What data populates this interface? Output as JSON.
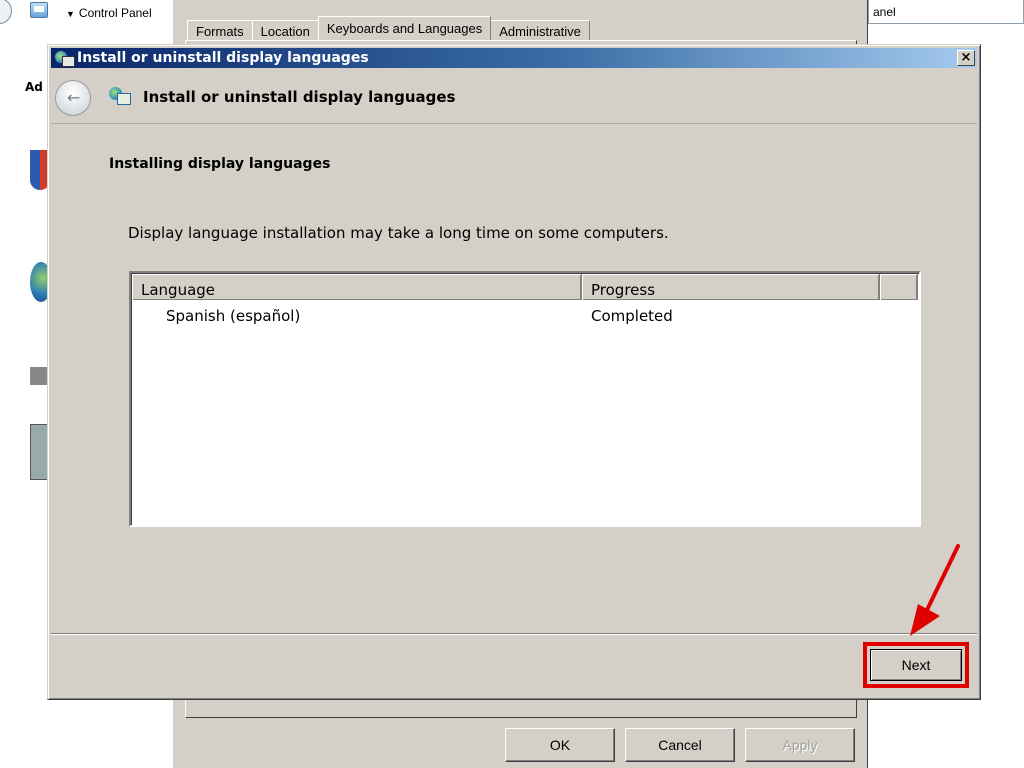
{
  "background": {
    "breadcrumb": "Control Panel",
    "search_text": "anel",
    "side_heading": "Ad",
    "dialog": {
      "tabs": [
        {
          "label": "Formats"
        },
        {
          "label": "Location"
        },
        {
          "label": "Keyboards and Languages",
          "selected": true
        },
        {
          "label": "Administrative"
        }
      ],
      "buttons": {
        "ok": "OK",
        "cancel": "Cancel",
        "apply": "Apply"
      }
    }
  },
  "dialog": {
    "window_title": "Install or uninstall display languages",
    "header_title": "Install or uninstall display languages",
    "section_title": "Installing display languages",
    "description": "Display language installation may take a long time on some computers.",
    "table": {
      "columns": [
        "Language",
        "Progress"
      ],
      "rows": [
        {
          "language": "Spanish (español)",
          "progress": "Completed"
        }
      ]
    },
    "close_symbol": "×",
    "next_label": "Next"
  },
  "colors": {
    "highlight": "#e00000",
    "title_start": "#0a246a",
    "title_end": "#a6caf0"
  }
}
